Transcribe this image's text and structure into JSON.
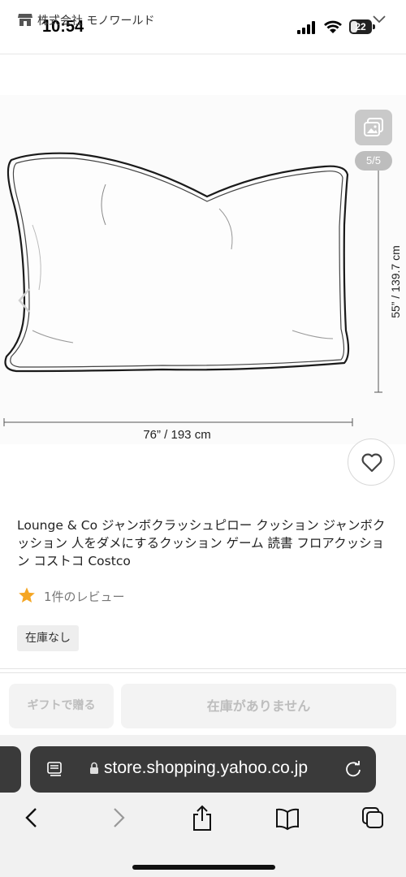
{
  "status_bar": {
    "time": "10:54",
    "battery": "22"
  },
  "store": {
    "name": "株式会社 モノワールド"
  },
  "gallery": {
    "counter": "5/5"
  },
  "image": {
    "height_label": "55” / 139.7 cm",
    "width_label": "76” / 193 cm"
  },
  "product": {
    "title": "Lounge & Co ジャンボクラッシュピロー クッション ジャンボクッション 人をダメにするクッション ゲーム 読書 フロアクッション コストコ Costco",
    "review_text": "1件のレビュー",
    "stock_status": "在庫なし"
  },
  "actions": {
    "gift_label": "ギフトで贈る",
    "stock_label": "在庫がありません"
  },
  "browser": {
    "url": "store.shopping.yahoo.co.jp"
  },
  "colors": {
    "star": "#f5a623",
    "url_bar": "#3a3a3a",
    "disabled_text": "#bdbdbd"
  },
  "icons": [
    "store-icon",
    "chevron-down-icon",
    "gallery-icon",
    "chevron-left-icon",
    "heart-icon",
    "star-icon",
    "reader-icon",
    "lock-icon",
    "reload-icon",
    "back-icon",
    "forward-icon",
    "share-icon",
    "bookmarks-icon",
    "tabs-icon"
  ]
}
